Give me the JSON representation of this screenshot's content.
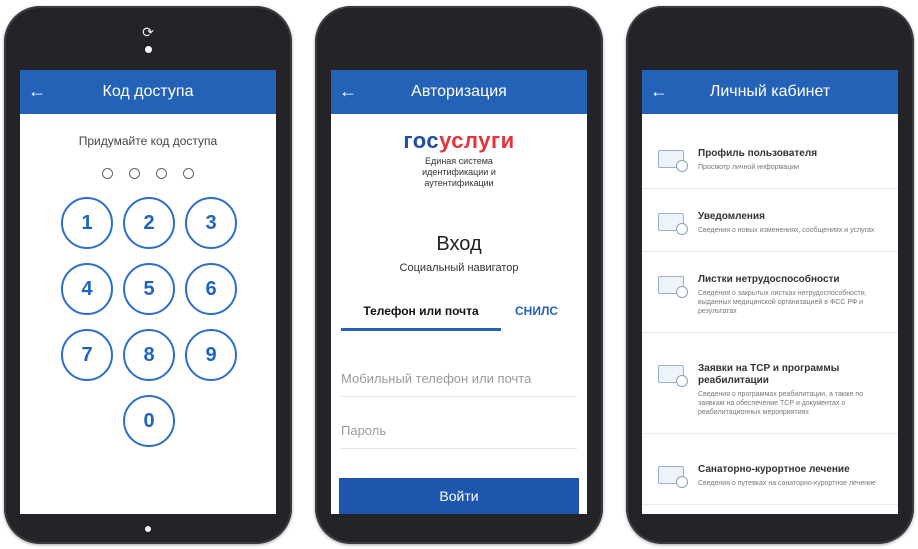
{
  "phones": {
    "pin": {
      "title": "Код доступа",
      "back_icon": "arrow-left-icon",
      "prompt": "Придумайте код доступа",
      "keys": [
        "1",
        "2",
        "3",
        "4",
        "5",
        "6",
        "7",
        "8",
        "9",
        "0"
      ]
    },
    "auth": {
      "title": "Авторизация",
      "logo": {
        "part1": "гос",
        "part2": "услуги"
      },
      "logo_subtitle": [
        "Единая система",
        "идентификации и",
        "аутентификации"
      ],
      "login_title": "Вход",
      "login_subtitle": "Социальный навигатор",
      "tabs": {
        "active": "Телефон или почта",
        "other": "СНИЛС"
      },
      "phone_placeholder": "Мобильный телефон или почта",
      "password_placeholder": "Пароль",
      "submit": "Войти"
    },
    "cabinet": {
      "title": "Личный кабинет",
      "items": [
        {
          "title": "Профиль пользователя",
          "desc": "Просмотр личной информации"
        },
        {
          "title": "Уведомления",
          "desc": "Сведения о новых изменениях, сообщениях и услугах"
        },
        {
          "title": "Листки нетрудоспособности",
          "desc": "Сведения о закрытых листках нетрудоспособности, выданных медицинской организацией в ФСС РФ и результатах"
        },
        {
          "title": "Заявки на ТСР и программы реабилитации",
          "desc": "Сведения о программах реабилитации, а также по заявкам на обеспечение ТСР и документах о реабилитационных мероприятиях"
        },
        {
          "title": "Санаторно-курортное лечение",
          "desc": "Сведения о путевках на санаторно-курортное лечение"
        }
      ]
    }
  },
  "colors": {
    "primary": "#2462b8",
    "logo_red": "#e3333b",
    "logo_blue": "#1d4ea4"
  }
}
